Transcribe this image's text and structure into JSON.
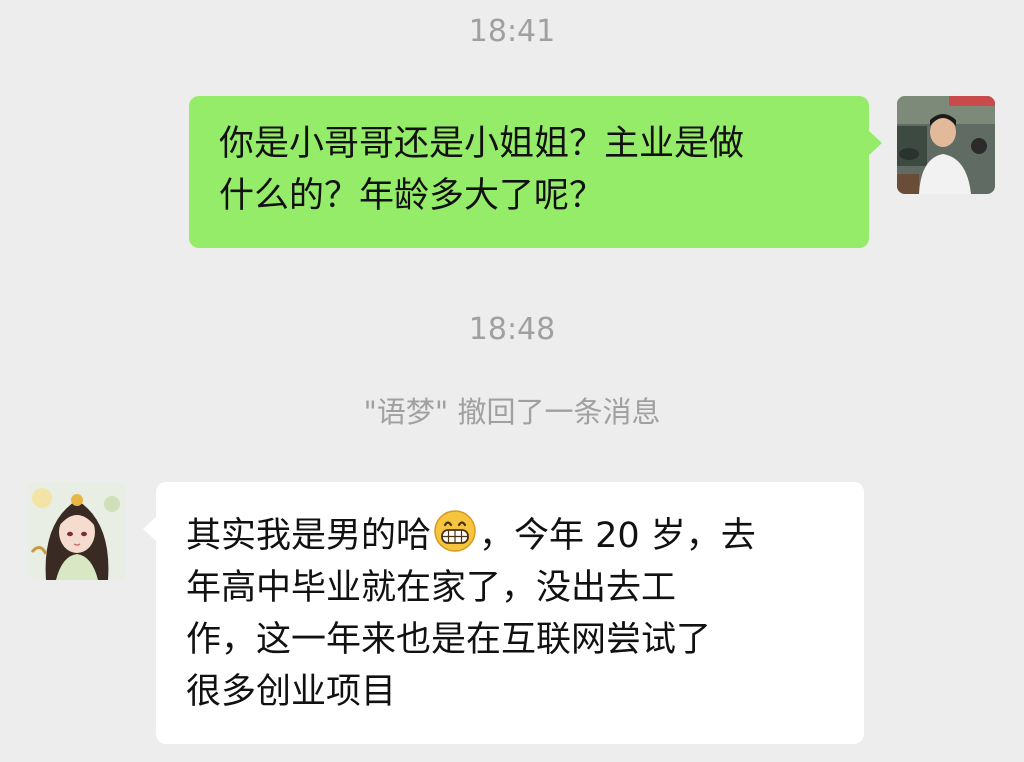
{
  "chat": {
    "timestamps": [
      "18:41",
      "18:48"
    ],
    "system_notice": "\"语梦\" 撤回了一条消息",
    "messages": [
      {
        "direction": "outgoing",
        "lines": [
          "你是小哥哥还是小姐姐？主业是做",
          "什么的？年龄多大了呢？"
        ]
      },
      {
        "direction": "incoming",
        "lines": [
          {
            "before_emoji": "其实我是男的哈",
            "emoji": "grinning-face-emoji",
            "after_emoji": "，今年 20 岁，去"
          },
          "年高中毕业就在家了，没出去工",
          "作，这一年来也是在互联网尝试了",
          "很多创业项目"
        ]
      }
    ]
  },
  "colors": {
    "background": "#ededed",
    "outgoing_bubble": "#95ec69",
    "incoming_bubble": "#ffffff",
    "meta_text": "#a0a0a0"
  }
}
